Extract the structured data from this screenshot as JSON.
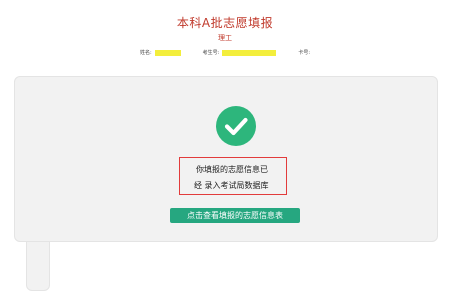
{
  "header": {
    "title": "本科A批志愿填报",
    "subtitle": "理工",
    "info": {
      "name_label": "姓名:",
      "exam_label": "考生号:",
      "card_label": "卡号:"
    }
  },
  "status": {
    "icon": "check-icon",
    "accent_color": "#2db67c",
    "message_line1": "你填报的志愿信息已",
    "message_line2": "经 录入考试局数据库"
  },
  "actions": {
    "view_button_label": "点击查看填报的志愿信息表"
  }
}
